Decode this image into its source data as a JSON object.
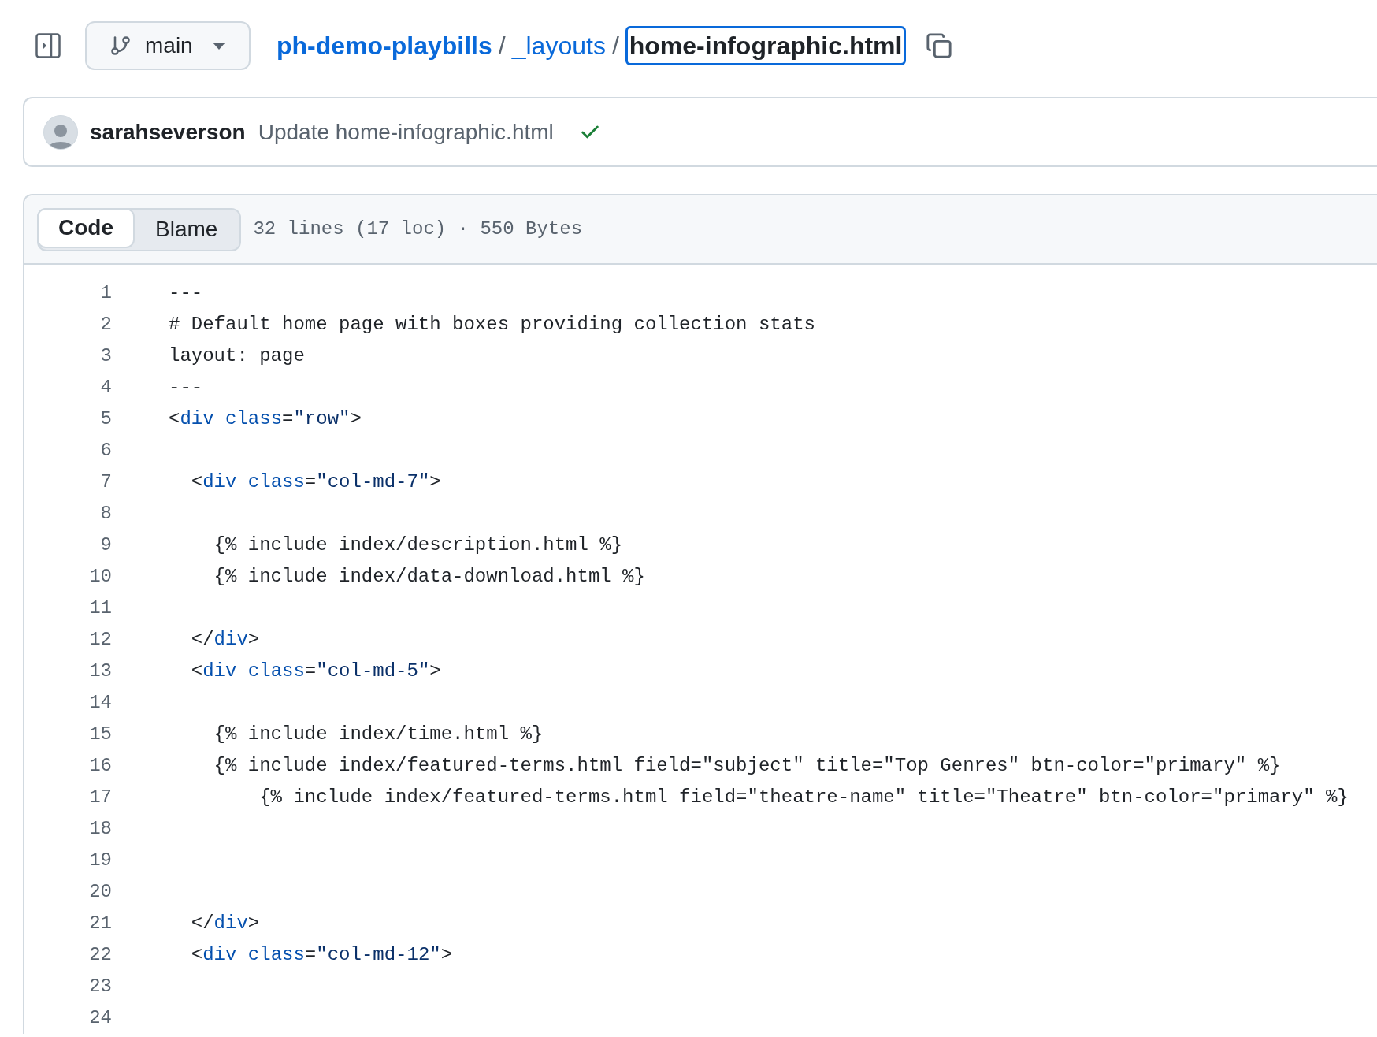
{
  "header": {
    "branch": {
      "name": "main"
    },
    "breadcrumb": [
      {
        "kind": "repo",
        "label": "ph-demo-playbills"
      },
      {
        "kind": "separator",
        "label": "/"
      },
      {
        "kind": "folder",
        "label": "_layouts"
      },
      {
        "kind": "separator",
        "label": "/"
      },
      {
        "kind": "file",
        "label": "home-infographic.html",
        "focused": true
      }
    ]
  },
  "commit": {
    "author": "sarahseverson",
    "message": "Update home-infographic.html",
    "checks_passed": true
  },
  "file_view": {
    "tabs": [
      {
        "label": "Code",
        "selected": true
      },
      {
        "label": "Blame",
        "selected": false
      }
    ],
    "file_info": "32 lines (17 loc) · 550 Bytes",
    "lines": [
      {
        "number": "1",
        "tokens": [
          {
            "kind": "plain",
            "text": "---"
          }
        ]
      },
      {
        "number": "2",
        "tokens": [
          {
            "kind": "plain",
            "text": "# Default home page with boxes providing collection stats"
          }
        ]
      },
      {
        "number": "3",
        "tokens": [
          {
            "kind": "plain",
            "text": "layout: page"
          }
        ]
      },
      {
        "number": "4",
        "tokens": [
          {
            "kind": "plain",
            "text": "---"
          }
        ]
      },
      {
        "number": "5",
        "tokens": [
          {
            "kind": "plain",
            "text": "<"
          },
          {
            "kind": "tag",
            "text": "div"
          },
          {
            "kind": "attr",
            "text": " class"
          },
          {
            "kind": "plain",
            "text": "="
          },
          {
            "kind": "string",
            "text": "\"row\""
          },
          {
            "kind": "plain",
            "text": ">"
          }
        ]
      },
      {
        "number": "6"
      },
      {
        "number": "7",
        "tokens": [
          {
            "kind": "plain",
            "text": "  <"
          },
          {
            "kind": "tag",
            "text": "div"
          },
          {
            "kind": "attr",
            "text": " class"
          },
          {
            "kind": "plain",
            "text": "="
          },
          {
            "kind": "string",
            "text": "\"col-md-7\""
          },
          {
            "kind": "plain",
            "text": ">"
          }
        ]
      },
      {
        "number": "8"
      },
      {
        "number": "9",
        "tokens": [
          {
            "kind": "plain",
            "text": "    {% include index/description.html %}"
          }
        ]
      },
      {
        "number": "10",
        "tokens": [
          {
            "kind": "plain",
            "text": "    {% include index/data-download.html %}"
          }
        ]
      },
      {
        "number": "11"
      },
      {
        "number": "12",
        "tokens": [
          {
            "kind": "plain",
            "text": "  </"
          },
          {
            "kind": "tag",
            "text": "div"
          },
          {
            "kind": "plain",
            "text": ">"
          }
        ]
      },
      {
        "number": "13",
        "tokens": [
          {
            "kind": "plain",
            "text": "  <"
          },
          {
            "kind": "tag",
            "text": "div"
          },
          {
            "kind": "attr",
            "text": " class"
          },
          {
            "kind": "plain",
            "text": "="
          },
          {
            "kind": "string",
            "text": "\"col-md-5\""
          },
          {
            "kind": "plain",
            "text": ">"
          }
        ]
      },
      {
        "number": "14"
      },
      {
        "number": "15",
        "tokens": [
          {
            "kind": "plain",
            "text": "    {% include index/time.html %}"
          }
        ]
      },
      {
        "number": "16",
        "tokens": [
          {
            "kind": "plain",
            "text": "    {% include index/featured-terms.html field=\"subject\" title=\"Top Genres\" btn-color=\"primary\" %}"
          }
        ]
      },
      {
        "number": "17",
        "tokens": [
          {
            "kind": "plain",
            "text": "        {% include index/featured-terms.html field=\"theatre-name\" title=\"Theatre\" btn-color=\"primary\" %}"
          }
        ]
      },
      {
        "number": "18"
      },
      {
        "number": "19"
      },
      {
        "number": "20"
      },
      {
        "number": "21",
        "tokens": [
          {
            "kind": "plain",
            "text": "  </"
          },
          {
            "kind": "tag",
            "text": "div"
          },
          {
            "kind": "plain",
            "text": ">"
          }
        ]
      },
      {
        "number": "22",
        "tokens": [
          {
            "kind": "plain",
            "text": "  <"
          },
          {
            "kind": "tag",
            "text": "div"
          },
          {
            "kind": "attr",
            "text": " class"
          },
          {
            "kind": "plain",
            "text": "="
          },
          {
            "kind": "string",
            "text": "\"col-md-12\""
          },
          {
            "kind": "plain",
            "text": ">"
          }
        ]
      },
      {
        "number": "23"
      },
      {
        "number": "24"
      }
    ]
  }
}
